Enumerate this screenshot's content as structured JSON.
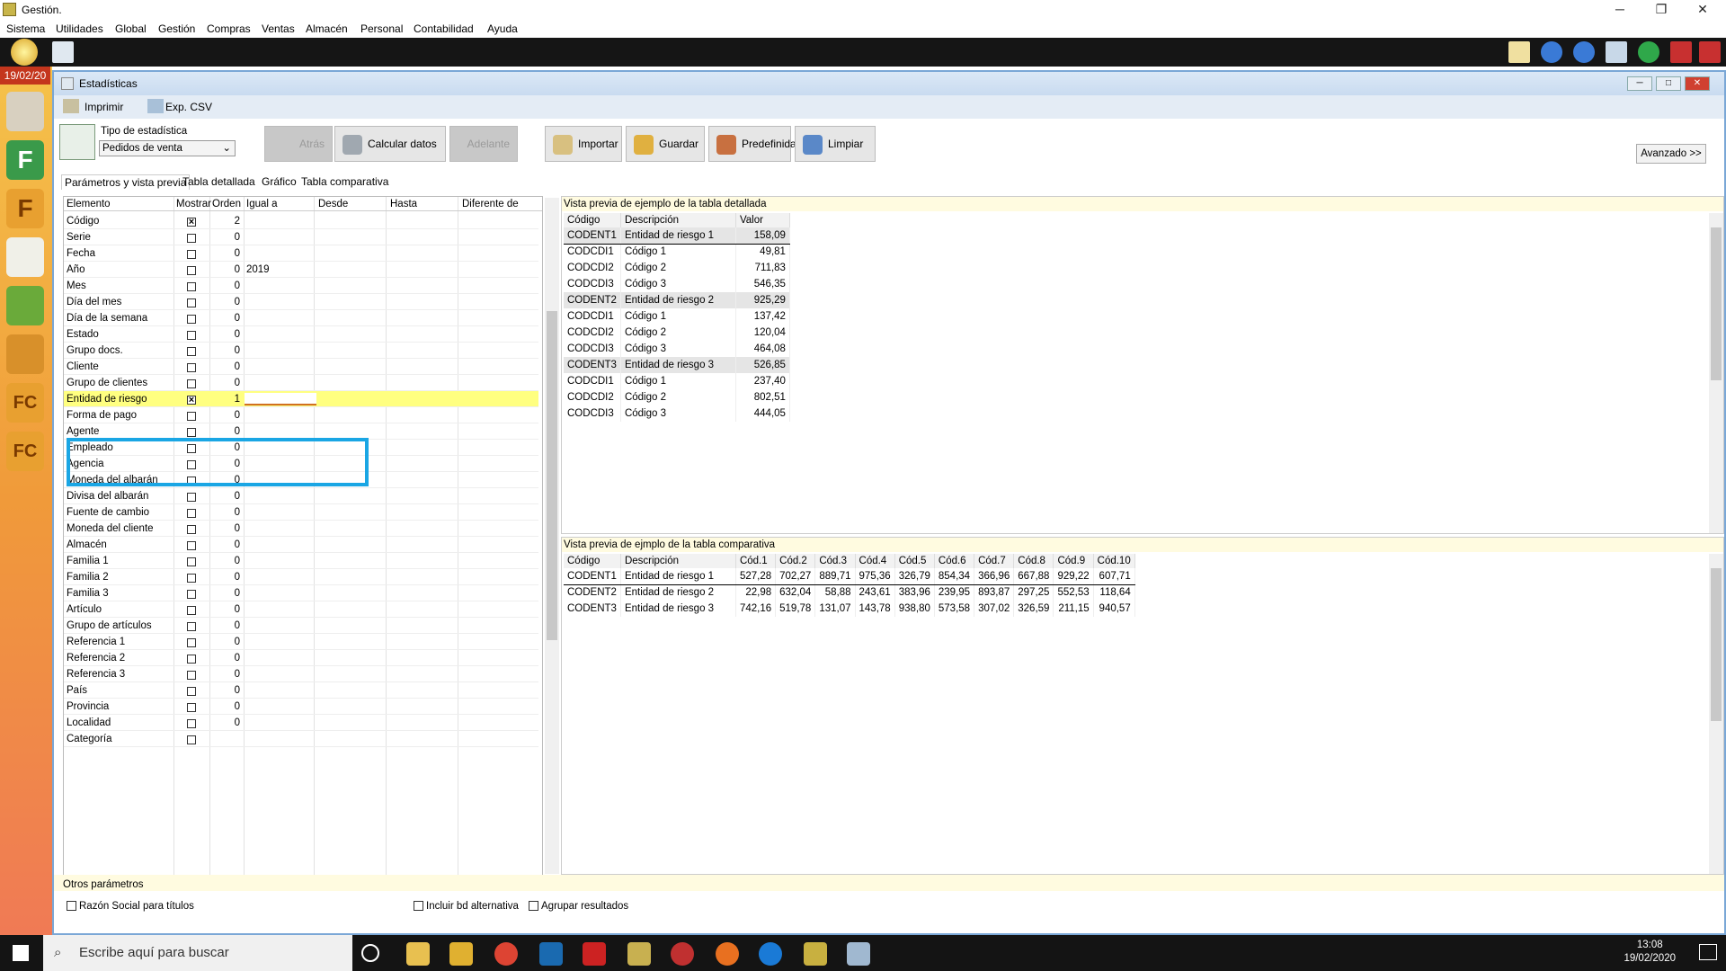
{
  "window": {
    "title": "Gestión."
  },
  "menu": [
    "Sistema",
    "Utilidades",
    "Global",
    "Gestión",
    "Compras",
    "Ventas",
    "Almacén",
    "Personal",
    "Contabilidad",
    "Ayuda"
  ],
  "sidebar": {
    "date": "19/02/20"
  },
  "child": {
    "title": "Estadísticas"
  },
  "strip": {
    "print": "Imprimir",
    "csv": "Exp. CSV"
  },
  "stat": {
    "label": "Tipo de estadística",
    "value": "Pedidos de venta"
  },
  "buttons": {
    "back": "Atrás",
    "calc": "Calcular datos",
    "forward": "Adelante",
    "import": "Importar",
    "save": "Guardar",
    "predef": "Predefinidas",
    "clear": "Limpiar",
    "advanced": "Avanzado >>"
  },
  "tabs": [
    "Parámetros y vista previa",
    "Tabla detallada",
    "Gráfico",
    "Tabla comparativa"
  ],
  "param_headers": [
    "Elemento",
    "Mostrar",
    "Orden",
    "Igual a",
    "Desde",
    "Hasta",
    "Diferente de"
  ],
  "params": [
    {
      "name": "Código",
      "show": "×",
      "order": "2",
      "eq": ""
    },
    {
      "name": "Serie",
      "show": "",
      "order": "0",
      "eq": ""
    },
    {
      "name": "Fecha",
      "show": "",
      "order": "0",
      "eq": ""
    },
    {
      "name": "Año",
      "show": "",
      "order": "0",
      "eq": "2019"
    },
    {
      "name": "Mes",
      "show": "",
      "order": "0",
      "eq": ""
    },
    {
      "name": "Día del mes",
      "show": "",
      "order": "0",
      "eq": ""
    },
    {
      "name": "Día de la semana",
      "show": "",
      "order": "0",
      "eq": ""
    },
    {
      "name": "Estado",
      "show": "",
      "order": "0",
      "eq": ""
    },
    {
      "name": "Grupo docs.",
      "show": "",
      "order": "0",
      "eq": ""
    },
    {
      "name": "Cliente",
      "show": "",
      "order": "0",
      "eq": ""
    },
    {
      "name": "Grupo de clientes",
      "show": "",
      "order": "0",
      "eq": ""
    },
    {
      "name": "Entidad de riesgo",
      "show": "×",
      "order": "1",
      "eq": ""
    },
    {
      "name": "Forma de pago",
      "show": "",
      "order": "0",
      "eq": ""
    },
    {
      "name": "Agente",
      "show": "",
      "order": "0",
      "eq": ""
    },
    {
      "name": "Empleado",
      "show": "",
      "order": "0",
      "eq": ""
    },
    {
      "name": "Agencia",
      "show": "",
      "order": "0",
      "eq": ""
    },
    {
      "name": "Moneda del albarán",
      "show": "",
      "order": "0",
      "eq": ""
    },
    {
      "name": "Divisa del albarán",
      "show": "",
      "order": "0",
      "eq": ""
    },
    {
      "name": "Fuente de cambio",
      "show": "",
      "order": "0",
      "eq": ""
    },
    {
      "name": "Moneda del cliente",
      "show": "",
      "order": "0",
      "eq": ""
    },
    {
      "name": "Almacén",
      "show": "",
      "order": "0",
      "eq": ""
    },
    {
      "name": "Familia 1",
      "show": "",
      "order": "0",
      "eq": ""
    },
    {
      "name": "Familia 2",
      "show": "",
      "order": "0",
      "eq": ""
    },
    {
      "name": "Familia 3",
      "show": "",
      "order": "0",
      "eq": ""
    },
    {
      "name": "Artículo",
      "show": "",
      "order": "0",
      "eq": ""
    },
    {
      "name": "Grupo de artículos",
      "show": "",
      "order": "0",
      "eq": ""
    },
    {
      "name": "Referencia 1",
      "show": "",
      "order": "0",
      "eq": ""
    },
    {
      "name": "Referencia 2",
      "show": "",
      "order": "0",
      "eq": ""
    },
    {
      "name": "Referencia 3",
      "show": "",
      "order": "0",
      "eq": ""
    },
    {
      "name": "País",
      "show": "",
      "order": "0",
      "eq": ""
    },
    {
      "name": "Provincia",
      "show": "",
      "order": "0",
      "eq": ""
    },
    {
      "name": "Localidad",
      "show": "",
      "order": "0",
      "eq": ""
    },
    {
      "name": "Categoría",
      "show": "",
      "order": "",
      "eq": ""
    }
  ],
  "detail": {
    "title": "Vista previa de ejemplo de la tabla detallada",
    "headers": [
      "Código",
      "Descripción",
      "Valor"
    ],
    "rows": [
      [
        "CODENT1",
        "Entidad de riesgo 1",
        "158,09"
      ],
      [
        "CODCDI1",
        "Código 1",
        "49,81"
      ],
      [
        "CODCDI2",
        "Código 2",
        "711,83"
      ],
      [
        "CODCDI3",
        "Código 3",
        "546,35"
      ],
      [
        "CODENT2",
        "Entidad de riesgo 2",
        "925,29"
      ],
      [
        "CODCDI1",
        "Código 1",
        "137,42"
      ],
      [
        "CODCDI2",
        "Código 2",
        "120,04"
      ],
      [
        "CODCDI3",
        "Código 3",
        "464,08"
      ],
      [
        "CODENT3",
        "Entidad de riesgo 3",
        "526,85"
      ],
      [
        "CODCDI1",
        "Código 1",
        "237,40"
      ],
      [
        "CODCDI2",
        "Código 2",
        "802,51"
      ],
      [
        "CODCDI3",
        "Código 3",
        "444,05"
      ]
    ]
  },
  "comparative": {
    "title": "Vista previa de ejmplo de la tabla comparativa",
    "headers": [
      "Código",
      "Descripción",
      "Cód.1",
      "Cód.2",
      "Cód.3",
      "Cód.4",
      "Cód.5",
      "Cód.6",
      "Cód.7",
      "Cód.8",
      "Cód.9",
      "Cód.10"
    ],
    "rows": [
      [
        "CODENT1",
        "Entidad de riesgo 1",
        "527,28",
        "702,27",
        "889,71",
        "975,36",
        "326,79",
        "854,34",
        "366,96",
        "667,88",
        "929,22",
        "607,71"
      ],
      [
        "CODENT2",
        "Entidad de riesgo 2",
        "22,98",
        "632,04",
        "58,88",
        "243,61",
        "383,96",
        "239,95",
        "893,87",
        "297,25",
        "552,53",
        "118,64"
      ],
      [
        "CODENT3",
        "Entidad de riesgo 3",
        "742,16",
        "519,78",
        "131,07",
        "143,78",
        "938,80",
        "573,58",
        "307,02",
        "326,59",
        "211,15",
        "940,57"
      ]
    ]
  },
  "footer": {
    "other": "Otros parámetros",
    "c1": "Razón Social para títulos",
    "c2": "Incluir bd alternativa",
    "c3": "Agrupar resultados"
  },
  "taskbar": {
    "search": "Escribe aquí para buscar",
    "time": "13:08",
    "date": "19/02/2020"
  }
}
